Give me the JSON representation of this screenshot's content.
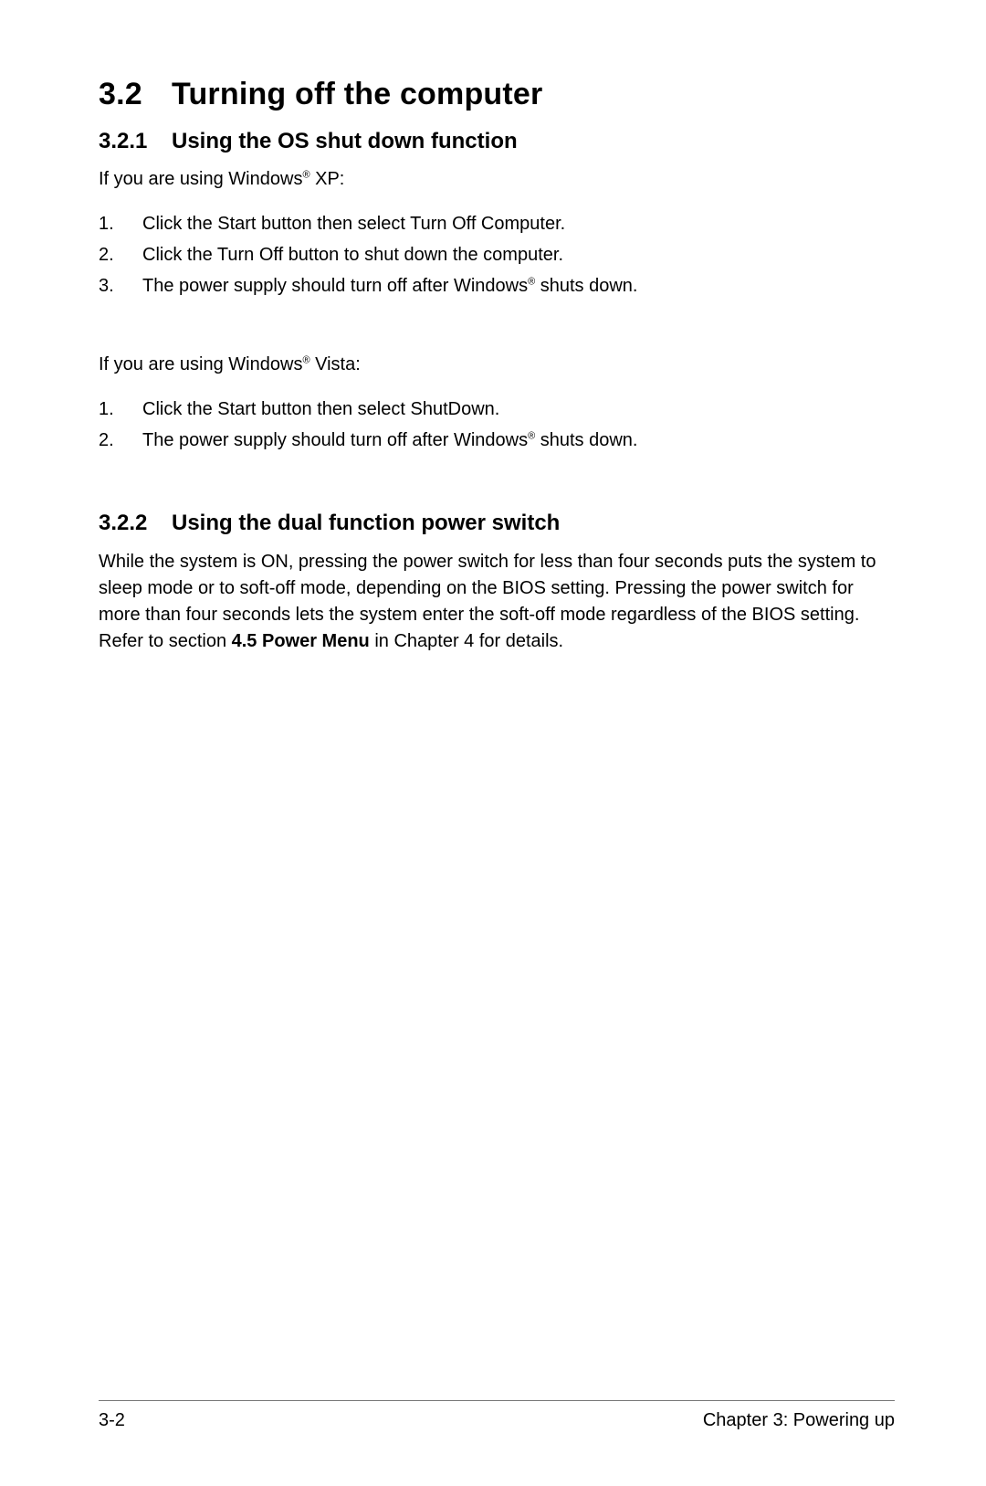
{
  "section": {
    "number": "3.2",
    "title": "Turning off the computer"
  },
  "sub1": {
    "number": "3.2.1",
    "title": "Using the OS shut down function",
    "intro_xp_a": "If you are using Windows",
    "intro_xp_b": " XP:",
    "xp_steps": [
      "Click the Start button then select Turn Off Computer.",
      "Click the Turn Off button to shut down the computer."
    ],
    "xp_step3_a": "The power supply should turn off after Windows",
    "xp_step3_b": " shuts down.",
    "intro_vista_a": "If you are using Windows",
    "intro_vista_b": " Vista:",
    "vista_step1": "Click the Start button then select ShutDown.",
    "vista_step2_a": "The power supply should turn off after Windows",
    "vista_step2_b": " shuts down."
  },
  "sub2": {
    "number": "3.2.2",
    "title": "Using the dual function power switch",
    "para_a": "While the system is ON, pressing the power switch for less than four seconds puts the system to sleep mode or to soft-off mode, depending on the BIOS setting. Pressing the power switch for more than four seconds lets the system enter the soft-off mode regardless of the BIOS setting. Refer to section ",
    "para_bold": "4.5  Power Menu",
    "para_c": " in Chapter 4 for details."
  },
  "footer": {
    "page": "3-2",
    "chapter": "Chapter 3: Powering up"
  },
  "reg": "®"
}
